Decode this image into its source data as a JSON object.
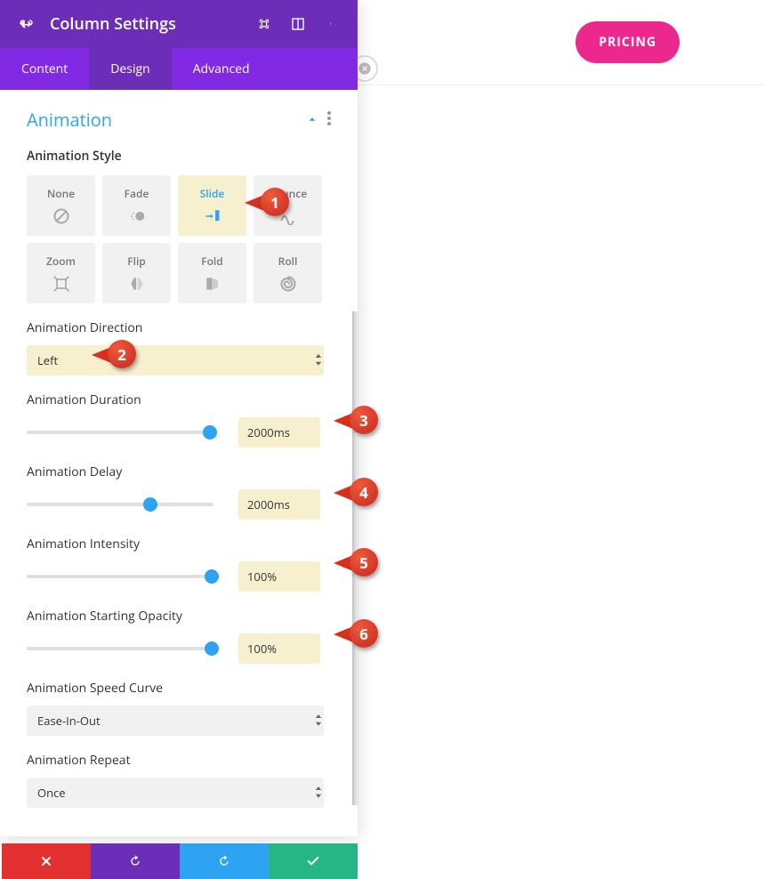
{
  "header": {
    "title": "Column Settings"
  },
  "tabs": {
    "content": "Content",
    "design": "Design",
    "advanced": "Advanced"
  },
  "section": {
    "title": "Animation"
  },
  "labels": {
    "animation_style": "Animation Style",
    "animation_direction": "Animation Direction",
    "animation_duration": "Animation Duration",
    "animation_delay": "Animation Delay",
    "animation_intensity": "Animation Intensity",
    "animation_opacity": "Animation Starting Opacity",
    "animation_speed_curve": "Animation Speed Curve",
    "animation_repeat": "Animation Repeat"
  },
  "styles": {
    "none": "None",
    "fade": "Fade",
    "slide": "Slide",
    "bounce": "Bounce",
    "zoom": "Zoom",
    "flip": "Flip",
    "fold": "Fold",
    "roll": "Roll"
  },
  "values": {
    "direction": "Left",
    "duration": "2000ms",
    "delay": "2000ms",
    "intensity": "100%",
    "opacity": "100%",
    "speed_curve": "Ease-In-Out",
    "repeat": "Once"
  },
  "slider_positions": {
    "duration_pct": 98,
    "delay_pct": 66,
    "intensity_pct": 99,
    "opacity_pct": 99
  },
  "callouts": {
    "c1": "1",
    "c2": "2",
    "c3": "3",
    "c4": "4",
    "c5": "5",
    "c6": "6"
  },
  "topbar": {
    "pricing": "PRICING"
  },
  "colors": {
    "purple_dark": "#6c2eb9",
    "purple": "#8129e3",
    "blue": "#2ea3f2",
    "pink": "#ec278d",
    "green": "#26b584",
    "red": "#e33030",
    "highlight": "#f6f0cf"
  }
}
